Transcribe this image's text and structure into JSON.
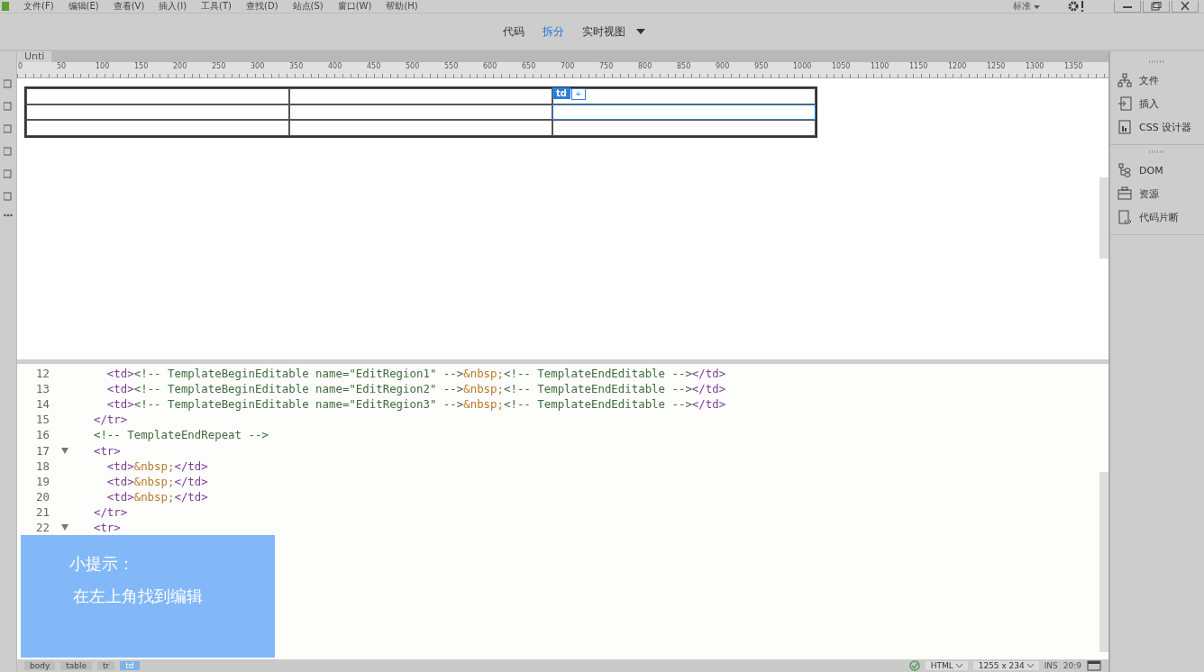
{
  "menu": [
    "文件(F)",
    "编辑(E)",
    "查看(V)",
    "插入(I)",
    "工具(T)",
    "查找(D)",
    "站点(S)",
    "窗口(W)",
    "帮助(H)"
  ],
  "workspace": {
    "label": "标准"
  },
  "view_tabs": [
    {
      "label": "代码",
      "selected": false
    },
    {
      "label": "拆分",
      "selected": true
    },
    {
      "label": "实时视图",
      "selected": false
    }
  ],
  "document_tab": "Unti",
  "ruler": [
    "0",
    "50",
    "100",
    "150",
    "200",
    "250",
    "300",
    "350",
    "400",
    "450",
    "500",
    "550",
    "600",
    "650",
    "700",
    "750",
    "800",
    "850",
    "900",
    "950",
    "1000",
    "1050",
    "1100",
    "1150",
    "1200",
    "1250",
    "1300",
    "1350"
  ],
  "design_table": {
    "rows": [
      [
        {
          "selected": false
        },
        {
          "selected": false
        },
        {
          "selected": false
        }
      ],
      [
        {
          "selected": false
        },
        {
          "selected": false
        },
        {
          "selected": true
        }
      ],
      [
        {
          "selected": false
        },
        {
          "selected": false
        },
        {
          "selected": false
        }
      ]
    ],
    "badge": "td",
    "badge_button": "+"
  },
  "code_lines": [
    {
      "num": "12",
      "fold": false,
      "segments": [
        {
          "kind": "tag",
          "text": "    <td>"
        },
        {
          "kind": "comment",
          "text": "<!-- TemplateBeginEditable name=\"EditRegion1\" -->"
        },
        {
          "kind": "entity",
          "text": "&nbsp;"
        },
        {
          "kind": "comment",
          "text": "<!-- TemplateEndEditable -->"
        },
        {
          "kind": "tag",
          "text": "</td>"
        }
      ]
    },
    {
      "num": "13",
      "fold": false,
      "segments": [
        {
          "kind": "tag",
          "text": "    <td>"
        },
        {
          "kind": "comment",
          "text": "<!-- TemplateBeginEditable name=\"EditRegion2\" -->"
        },
        {
          "kind": "entity",
          "text": "&nbsp;"
        },
        {
          "kind": "comment",
          "text": "<!-- TemplateEndEditable -->"
        },
        {
          "kind": "tag",
          "text": "</td>"
        }
      ]
    },
    {
      "num": "14",
      "fold": false,
      "segments": [
        {
          "kind": "tag",
          "text": "    <td>"
        },
        {
          "kind": "comment",
          "text": "<!-- TemplateBeginEditable name=\"EditRegion3\" -->"
        },
        {
          "kind": "entity",
          "text": "&nbsp;"
        },
        {
          "kind": "comment",
          "text": "<!-- TemplateEndEditable -->"
        },
        {
          "kind": "tag",
          "text": "</td>"
        }
      ]
    },
    {
      "num": "15",
      "fold": false,
      "segments": [
        {
          "kind": "tag",
          "text": "  </tr>"
        }
      ]
    },
    {
      "num": "16",
      "fold": false,
      "segments": [
        {
          "kind": "comment",
          "text": "  <!-- TemplateEndRepeat -->"
        }
      ]
    },
    {
      "num": "17",
      "fold": true,
      "segments": [
        {
          "kind": "tag",
          "text": "  <tr>"
        }
      ]
    },
    {
      "num": "18",
      "fold": false,
      "segments": [
        {
          "kind": "tag",
          "text": "    <td>"
        },
        {
          "kind": "entity",
          "text": "&nbsp;"
        },
        {
          "kind": "tag",
          "text": "</td>"
        }
      ]
    },
    {
      "num": "19",
      "fold": false,
      "segments": [
        {
          "kind": "tag",
          "text": "    <td>"
        },
        {
          "kind": "entity",
          "text": "&nbsp;"
        },
        {
          "kind": "tag",
          "text": "</td>"
        }
      ]
    },
    {
      "num": "20",
      "fold": false,
      "segments": [
        {
          "kind": "tag",
          "text": "    <td>"
        },
        {
          "kind": "entity",
          "text": "&nbsp;"
        },
        {
          "kind": "tag",
          "text": "</td>"
        }
      ]
    },
    {
      "num": "21",
      "fold": false,
      "segments": [
        {
          "kind": "tag",
          "text": "  </tr>"
        }
      ]
    },
    {
      "num": "22",
      "fold": true,
      "segments": [
        {
          "kind": "tag",
          "text": "  <tr>"
        }
      ]
    }
  ],
  "tip": {
    "title": "小提示：",
    "text": "在左上角找到编辑"
  },
  "panel_groups": [
    [
      {
        "label": "文件"
      },
      {
        "label": "插入"
      },
      {
        "label": "CSS 设计器"
      }
    ],
    [
      {
        "label": "DOM"
      },
      {
        "label": "资源"
      },
      {
        "label": "代码片断"
      }
    ]
  ],
  "status": {
    "breadcrumbs": [
      {
        "label": "body",
        "selected": false
      },
      {
        "label": "table",
        "selected": false
      },
      {
        "label": "tr",
        "selected": false
      },
      {
        "label": "td",
        "selected": true
      }
    ],
    "doc_type": "HTML",
    "size": "1255 x 234",
    "mode": "INS",
    "position": "20:9"
  }
}
